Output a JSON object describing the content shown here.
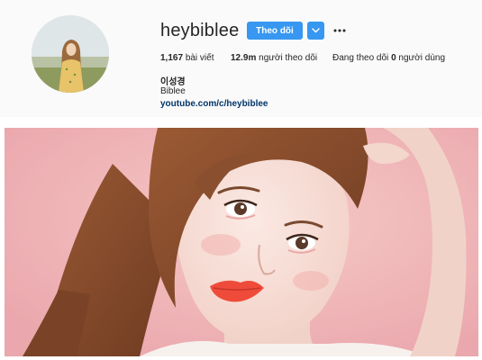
{
  "profile": {
    "username": "heybiblee",
    "follow_label": "Theo dõi",
    "posts_count": "1,167",
    "posts_label": "bài viết",
    "followers_count": "12.9m",
    "followers_label": "người theo dõi",
    "following_prefix": "Đang theo dõi",
    "following_count": "0",
    "following_suffix": "người dùng",
    "real_name": "이성경",
    "bio": "Biblee",
    "link": "youtube.com/c/heybiblee"
  },
  "icons": {
    "verified": "verified-badge-icon",
    "dropdown": "chevron-down-icon",
    "more": "more-options-icon"
  },
  "colors": {
    "primary_button": "#3897f0",
    "link": "#003569",
    "header_bg": "#fafafa",
    "photo_bg": "#f0b4b6"
  }
}
